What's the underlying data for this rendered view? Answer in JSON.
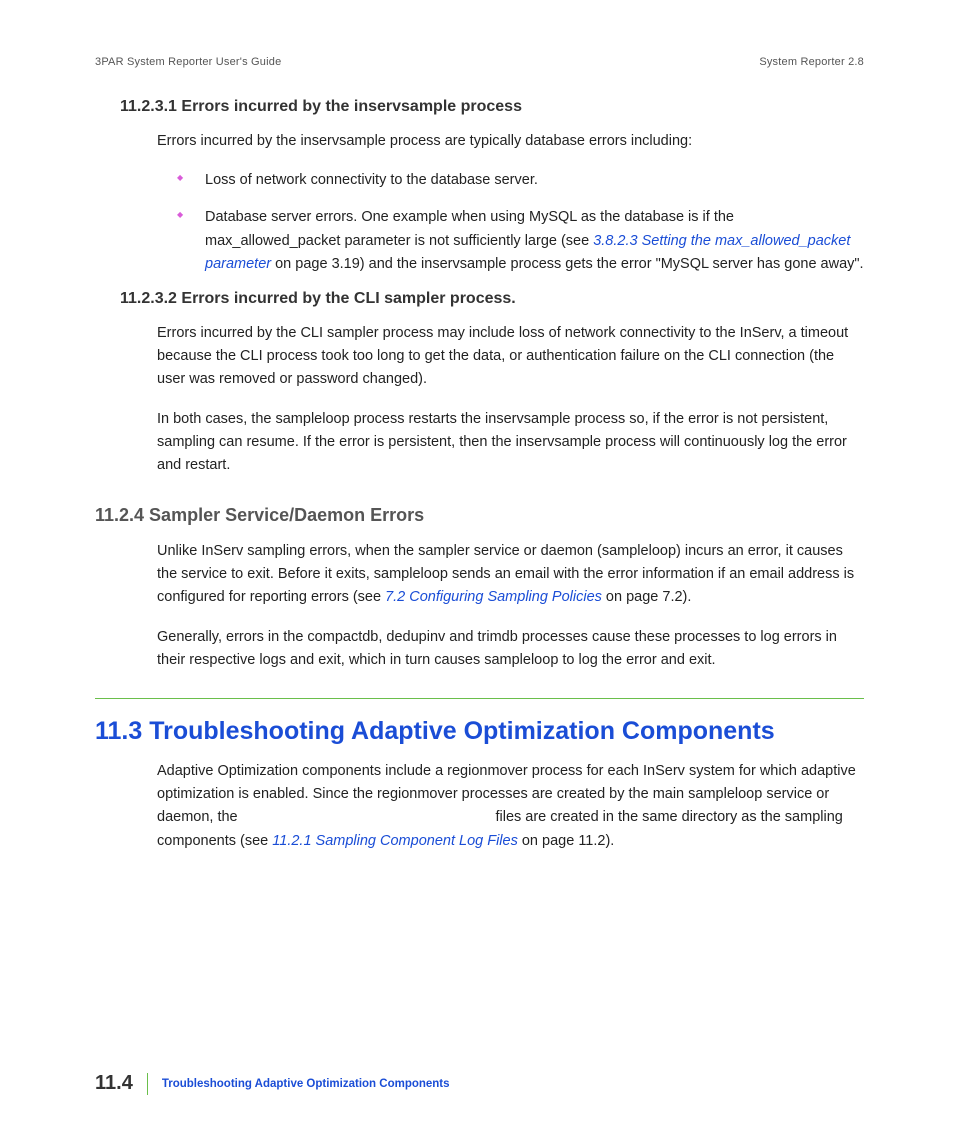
{
  "header": {
    "left": "3PAR System Reporter User's Guide",
    "right": "System Reporter 2.8"
  },
  "s1": {
    "heading": "11.2.3.1 Errors incurred by the inservsample process",
    "intro": "Errors incurred by the inservsample process are typically database errors including:",
    "b1": "Loss of network connectivity to the database server.",
    "b2a": "Database server errors. One example when using MySQL as the database is if the max_allowed_packet parameter is not sufficiently large (see ",
    "b2link": "3.8.2.3 Setting the max_allowed_packet parameter",
    "b2b": " on page 3.19) and the inservsample process gets the error \"MySQL server has gone away\"."
  },
  "s2": {
    "heading": "11.2.3.2 Errors incurred by the CLI sampler process.",
    "p1": "Errors incurred by the CLI sampler process may include loss of network connectivity to the InServ, a timeout because the CLI process took too long to get the data, or authentication failure on the CLI connection (the user was removed or password changed).",
    "p2": "In both cases, the sampleloop process restarts the inservsample process so, if the error is not persistent, sampling can resume. If the error is persistent, then the inservsample process will continuously log the error and restart."
  },
  "s3": {
    "heading": "11.2.4 Sampler Service/Daemon Errors",
    "p1a": "Unlike InServ sampling errors, when the sampler service or daemon (sampleloop) incurs an error, it causes the service to exit. Before it exits, sampleloop sends an email with the error information if an email address is configured for reporting errors (see ",
    "p1link": "7.2 Configuring Sampling Policies",
    "p1b": " on page 7.2).",
    "p2": "Generally, errors in the compactdb, dedupinv and trimdb processes cause these processes to log errors in their respective logs and exit, which in turn causes sampleloop to log the error and exit."
  },
  "s4": {
    "heading": "11.3 Troubleshooting Adaptive Optimization Components",
    "p1a": "Adaptive Optimization components include a regionmover process for each InServ system for which adaptive optimization is enabled. Since the regionmover processes are created by the main sampleloop service or daemon, the ",
    "p1gap": "                                                              ",
    "p1b": " files are created in the same directory as the sampling components (see ",
    "p1link": "11.2.1 Sampling Component Log Files",
    "p1c": " on page 11.2)."
  },
  "footer": {
    "page": "11.4",
    "title": "Troubleshooting Adaptive Optimization Components"
  }
}
